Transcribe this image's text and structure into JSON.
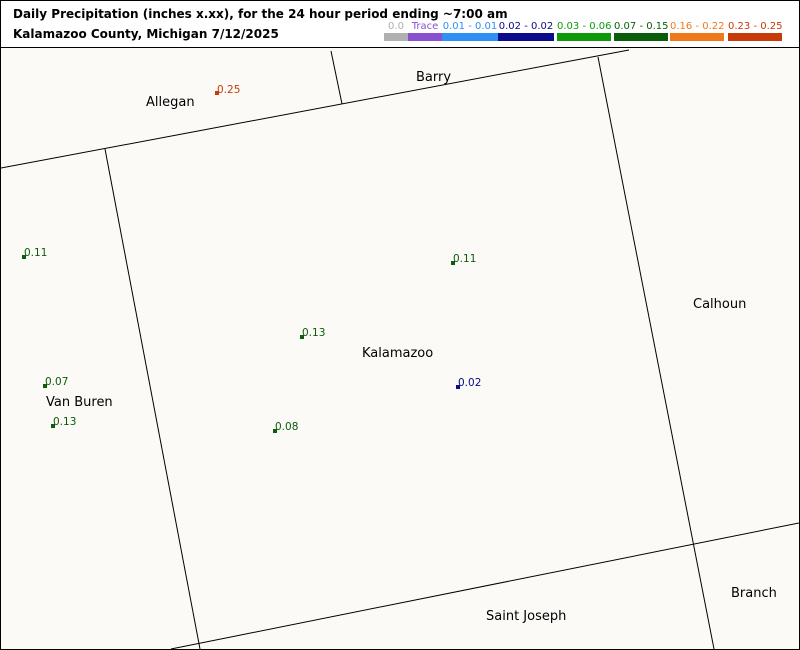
{
  "header": {
    "title_line1": "Daily Precipitation (inches  x.xx),  for the 24 hour period ending ~7:00 am",
    "title_line2": "Kalamazoo County, Michigan  7/12/2025"
  },
  "legend": [
    {
      "label": "0.0",
      "color": "#b0b0b0"
    },
    {
      "label": "Trace",
      "color": "#8a4fcf"
    },
    {
      "label": "0.01 - 0.01",
      "color": "#2e8ff5"
    },
    {
      "label": "0.02 - 0.02",
      "color": "#0a0a8c"
    },
    {
      "label": "0.03 - 0.06",
      "color": "#0c9a0c"
    },
    {
      "label": "0.07 - 0.15",
      "color": "#0b5c0b"
    },
    {
      "label": "0.16 - 0.22",
      "color": "#f07818"
    },
    {
      "label": "0.23 - 0.25",
      "color": "#c83a0a"
    }
  ],
  "counties": {
    "barry": "Barry",
    "allegan": "Allegan",
    "calhoun": "Calhoun",
    "kalamazoo": "Kalamazoo",
    "van_buren": "Van Buren",
    "branch": "Branch",
    "saint_joseph": "Saint Joseph"
  },
  "stations": [
    {
      "value": "0.25",
      "color": "#c83a0a"
    },
    {
      "value": "0.11",
      "color": "#0b5c0b"
    },
    {
      "value": "0.11",
      "color": "#0b5c0b"
    },
    {
      "value": "0.13",
      "color": "#0b5c0b"
    },
    {
      "value": "0.02",
      "color": "#0a0a8c"
    },
    {
      "value": "0.07",
      "color": "#0b5c0b"
    },
    {
      "value": "0.13",
      "color": "#0b5c0b"
    },
    {
      "value": "0.08",
      "color": "#0b5c0b"
    }
  ]
}
